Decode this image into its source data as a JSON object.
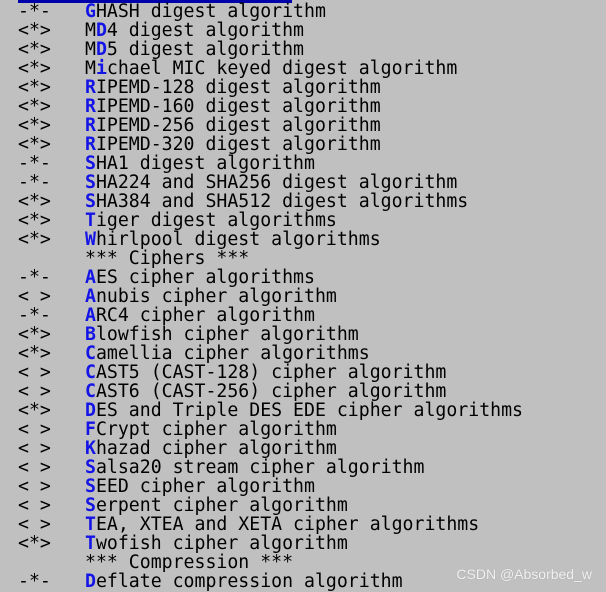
{
  "colors": {
    "background": "#c0c0c0",
    "text": "#000000",
    "hotkey": "#1414e6",
    "highlight_bar": "#0000aa"
  },
  "rows": [
    {
      "type": "item",
      "state": "-*-",
      "prefix": "",
      "hot": "G",
      "rest": "HASH digest algorithm"
    },
    {
      "type": "item",
      "state": "<*>",
      "prefix": "M",
      "hot": "D",
      "rest": "4 digest algorithm"
    },
    {
      "type": "item",
      "state": "<*>",
      "prefix": "M",
      "hot": "D",
      "rest": "5 digest algorithm"
    },
    {
      "type": "item",
      "state": "<*>",
      "prefix": "M",
      "hot": "i",
      "rest": "chael MIC keyed digest algorithm"
    },
    {
      "type": "item",
      "state": "<*>",
      "prefix": "",
      "hot": "R",
      "rest": "IPEMD-128 digest algorithm"
    },
    {
      "type": "item",
      "state": "<*>",
      "prefix": "",
      "hot": "R",
      "rest": "IPEMD-160 digest algorithm"
    },
    {
      "type": "item",
      "state": "<*>",
      "prefix": "",
      "hot": "R",
      "rest": "IPEMD-256 digest algorithm"
    },
    {
      "type": "item",
      "state": "<*>",
      "prefix": "",
      "hot": "R",
      "rest": "IPEMD-320 digest algorithm"
    },
    {
      "type": "item",
      "state": "-*-",
      "prefix": "",
      "hot": "S",
      "rest": "HA1 digest algorithm"
    },
    {
      "type": "item",
      "state": "-*-",
      "prefix": "",
      "hot": "S",
      "rest": "HA224 and SHA256 digest algorithm"
    },
    {
      "type": "item",
      "state": "<*>",
      "prefix": "",
      "hot": "S",
      "rest": "HA384 and SHA512 digest algorithms"
    },
    {
      "type": "item",
      "state": "<*>",
      "prefix": "",
      "hot": "T",
      "rest": "iger digest algorithms"
    },
    {
      "type": "item",
      "state": "<*>",
      "prefix": "",
      "hot": "W",
      "rest": "hirlpool digest algorithms"
    },
    {
      "type": "section",
      "state": "",
      "prefix": "",
      "hot": "",
      "rest": "*** Ciphers ***"
    },
    {
      "type": "item",
      "state": "-*-",
      "prefix": "",
      "hot": "A",
      "rest": "ES cipher algorithms"
    },
    {
      "type": "item",
      "state": "< >",
      "prefix": "",
      "hot": "A",
      "rest": "nubis cipher algorithm"
    },
    {
      "type": "item",
      "state": "-*-",
      "prefix": "",
      "hot": "A",
      "rest": "RC4 cipher algorithm"
    },
    {
      "type": "item",
      "state": "<*>",
      "prefix": "",
      "hot": "B",
      "rest": "lowfish cipher algorithm"
    },
    {
      "type": "item",
      "state": "<*>",
      "prefix": "",
      "hot": "C",
      "rest": "amellia cipher algorithms"
    },
    {
      "type": "item",
      "state": "< >",
      "prefix": "",
      "hot": "C",
      "rest": "AST5 (CAST-128) cipher algorithm"
    },
    {
      "type": "item",
      "state": "< >",
      "prefix": "",
      "hot": "C",
      "rest": "AST6 (CAST-256) cipher algorithm"
    },
    {
      "type": "item",
      "state": "<*>",
      "prefix": "",
      "hot": "D",
      "rest": "ES and Triple DES EDE cipher algorithms"
    },
    {
      "type": "item",
      "state": "< >",
      "prefix": "",
      "hot": "F",
      "rest": "Crypt cipher algorithm"
    },
    {
      "type": "item",
      "state": "< >",
      "prefix": "",
      "hot": "K",
      "rest": "hazad cipher algorithm"
    },
    {
      "type": "item",
      "state": "< >",
      "prefix": "",
      "hot": "S",
      "rest": "alsa20 stream cipher algorithm"
    },
    {
      "type": "item",
      "state": "< >",
      "prefix": "",
      "hot": "S",
      "rest": "EED cipher algorithm"
    },
    {
      "type": "item",
      "state": "< >",
      "prefix": "",
      "hot": "S",
      "rest": "erpent cipher algorithm"
    },
    {
      "type": "item",
      "state": "< >",
      "prefix": "",
      "hot": "T",
      "rest": "EA, XTEA and XETA cipher algorithms"
    },
    {
      "type": "item",
      "state": "<*>",
      "prefix": "",
      "hot": "T",
      "rest": "wofish cipher algorithm"
    },
    {
      "type": "section",
      "state": "",
      "prefix": "",
      "hot": "",
      "rest": "*** Compression ***"
    },
    {
      "type": "item",
      "state": "-*-",
      "prefix": "",
      "hot": "D",
      "rest": "eflate compression algorithm"
    }
  ],
  "watermark": "CSDN @Absorbed_w"
}
